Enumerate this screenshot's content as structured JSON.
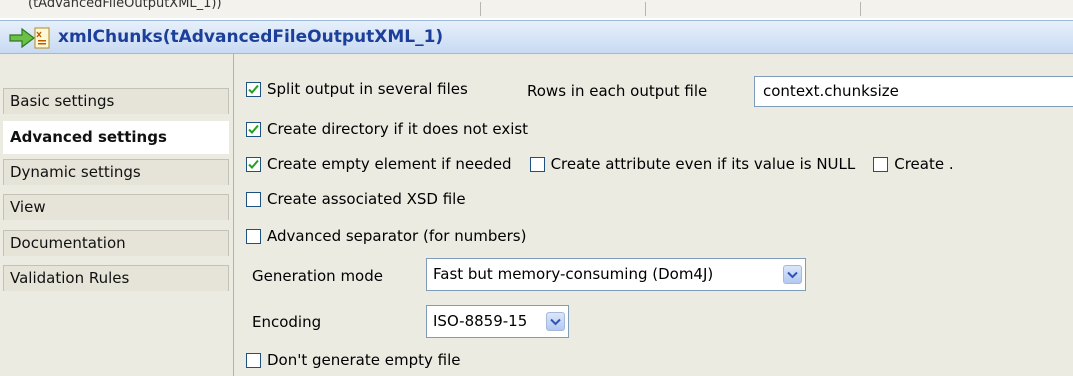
{
  "top_strip": {
    "breadcrumb": "(tAdvancedFileOutputXML_1))"
  },
  "header": {
    "title": "xmlChunks(tAdvancedFileOutputXML_1)"
  },
  "sidebar": {
    "items": [
      {
        "label": "Basic settings",
        "active": false
      },
      {
        "label": "Advanced settings",
        "active": true
      },
      {
        "label": "Dynamic settings",
        "active": false
      },
      {
        "label": "View",
        "active": false
      },
      {
        "label": "Documentation",
        "active": false
      },
      {
        "label": "Validation Rules",
        "active": false
      }
    ]
  },
  "options": {
    "split_output": {
      "label": "Split output in several files",
      "checked": true
    },
    "rows_label": "Rows in each output file",
    "rows_value": "context.chunksize",
    "create_directory": {
      "label": "Create directory if it does not exist",
      "checked": true
    },
    "create_empty_element": {
      "label": "Create empty element if needed",
      "checked": true
    },
    "create_attribute_null": {
      "label": "Create attribute even if its value is NULL",
      "checked": false
    },
    "create_truncated": {
      "label": "Create .",
      "checked": false
    },
    "create_xsd": {
      "label": "Create associated XSD file",
      "checked": false
    },
    "advanced_separator": {
      "label": "Advanced separator (for numbers)",
      "checked": false
    },
    "generation_mode": {
      "label": "Generation mode",
      "value": "Fast but memory-consuming (Dom4J)"
    },
    "encoding": {
      "label": "Encoding",
      "value": "ISO-8859-15"
    },
    "dont_generate_empty": {
      "label": "Don't generate empty file",
      "checked": false
    }
  },
  "colors": {
    "title": "#1c3f9a",
    "panel_bg": "#ecebe2",
    "check": "#21a121"
  },
  "icons": {
    "header": "component-arrow-xml-icon",
    "check": "checkmark-icon",
    "dropdown": "chevron-down-icon"
  }
}
